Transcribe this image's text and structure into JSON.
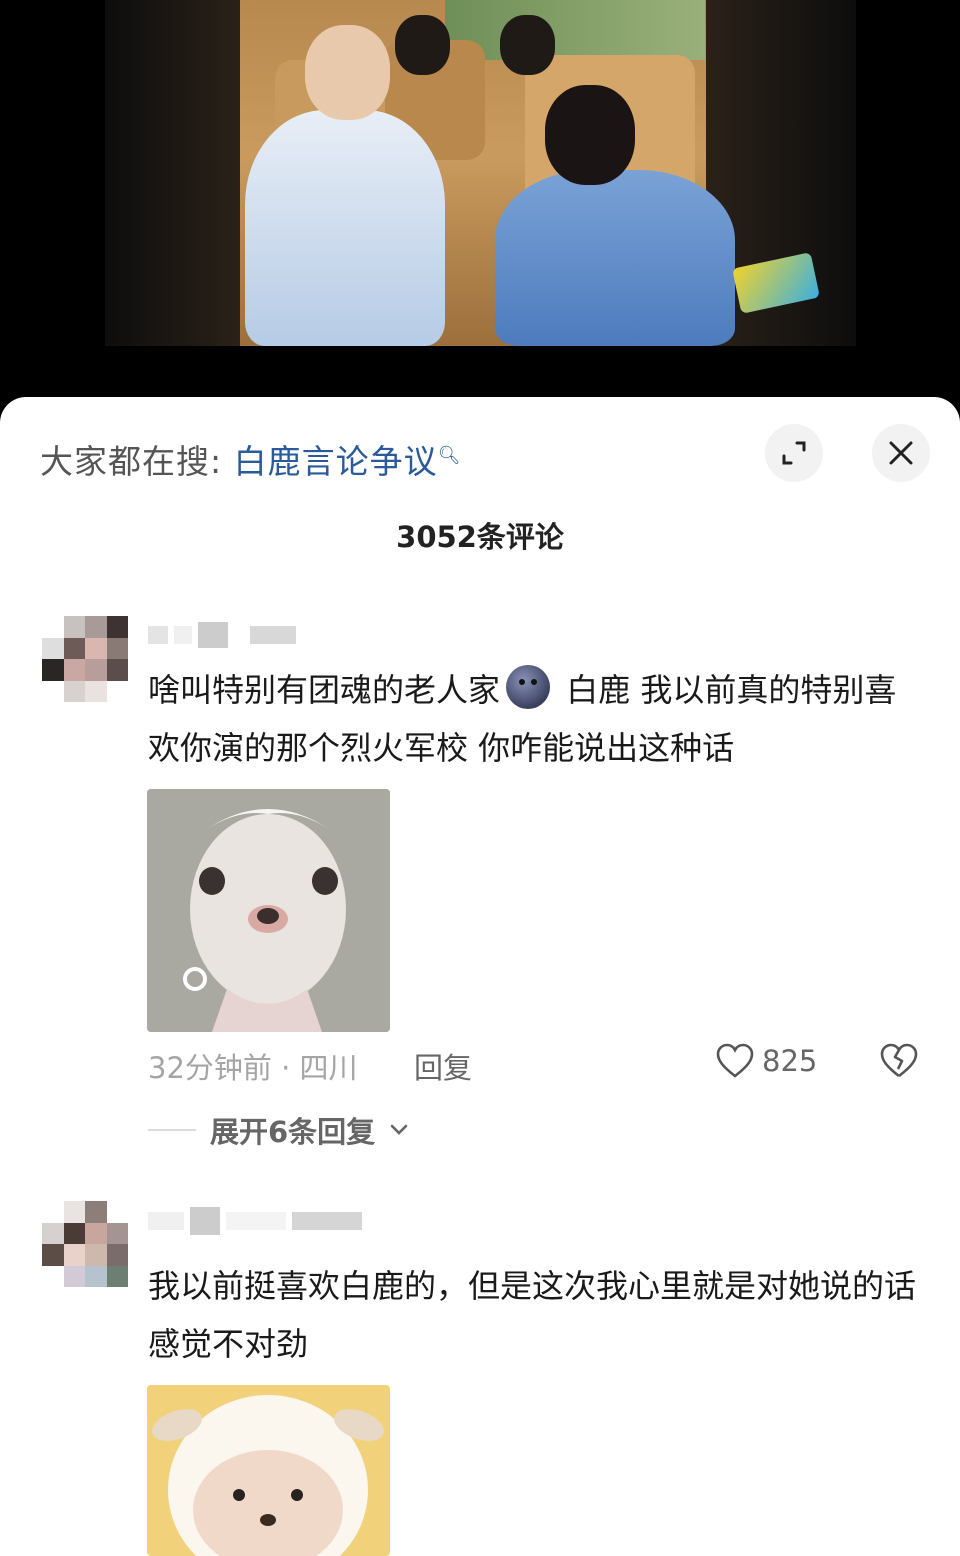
{
  "video": {},
  "sheet": {
    "search_prefix": "大家都在搜:",
    "search_term": "白鹿言论争议",
    "comment_count": "3052条评论",
    "expand_icon": "expand-icon",
    "close_icon": "close-icon"
  },
  "comments": [
    {
      "text_before_emoji": "啥叫特别有团魂的老人家",
      "text_after_emoji": " 白鹿 我以前真的特别喜欢你演的那个烈火军校 你咋能说出这种话",
      "meta": "32分钟前 · 四川",
      "reply_label": "回复",
      "likes": "825",
      "expand_label": "展开6条回复"
    },
    {
      "text": "我以前挺喜欢白鹿的，但是这次我心里就是对她说的话感觉不对劲"
    }
  ]
}
